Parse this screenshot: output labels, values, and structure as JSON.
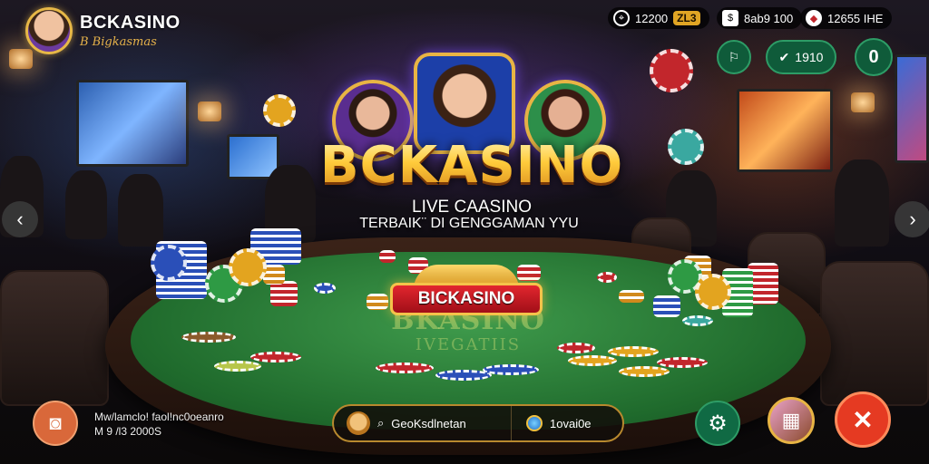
{
  "brand": {
    "title": "BCKASINO",
    "subtitle": "B Bigkasmas"
  },
  "status_bar": {
    "location_value": "12200",
    "level": "ZL3",
    "coins_value": "8ab9 100",
    "gems_value": "12655 IHE"
  },
  "top_buttons": {
    "friends_label": "",
    "rewards_label": "1910",
    "settings_label": "0"
  },
  "hero": {
    "logo": "BCKASINO",
    "tagline_line1": "LIVE CAASINO",
    "tagline_line2": "TERBAIK¨ DI GENGGAMAN YYU"
  },
  "table": {
    "badge": "BICKASINO",
    "felt_brand": "BKASINO",
    "felt_sub": "IVEGATIIS"
  },
  "bottom": {
    "info_line1": "Mw/lamclo! faol!nc0oeanro",
    "info_line2": "M 9 /l3 2000S",
    "search_label": "GeoKsdlnetan",
    "balance_label": "1ovai0e"
  },
  "colors": {
    "accent_gold": "#e8b444",
    "brand_red": "#d3202a",
    "felt_green": "#2f8a3c",
    "button_green": "#0f5b3a"
  },
  "icons": {
    "camera": "camera-icon",
    "gear": "gear-icon",
    "gift": "gift-box-icon",
    "close": "close-x-icon",
    "location": "location-pin-icon",
    "coins": "coin-icon",
    "gems": "gem-icon"
  }
}
